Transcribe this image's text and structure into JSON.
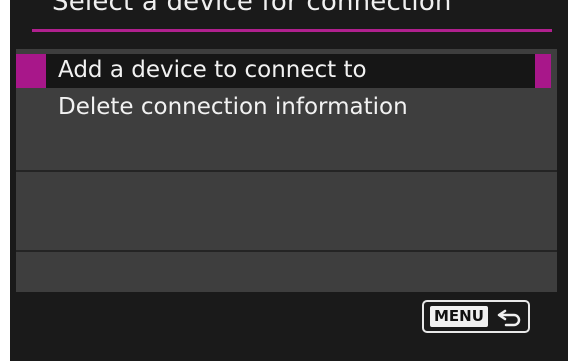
{
  "screen": {
    "title": "Select a device for connection"
  },
  "menu": {
    "items": [
      {
        "label": "Add a device to connect to",
        "selected": true
      },
      {
        "label": "Delete connection information",
        "selected": false
      }
    ]
  },
  "footer": {
    "menu_label": "MENU",
    "return_icon": "return-arrow-icon"
  },
  "colors": {
    "accent": "#a8178a",
    "panel": "#3e3e3e",
    "background": "#1a1a1a"
  }
}
